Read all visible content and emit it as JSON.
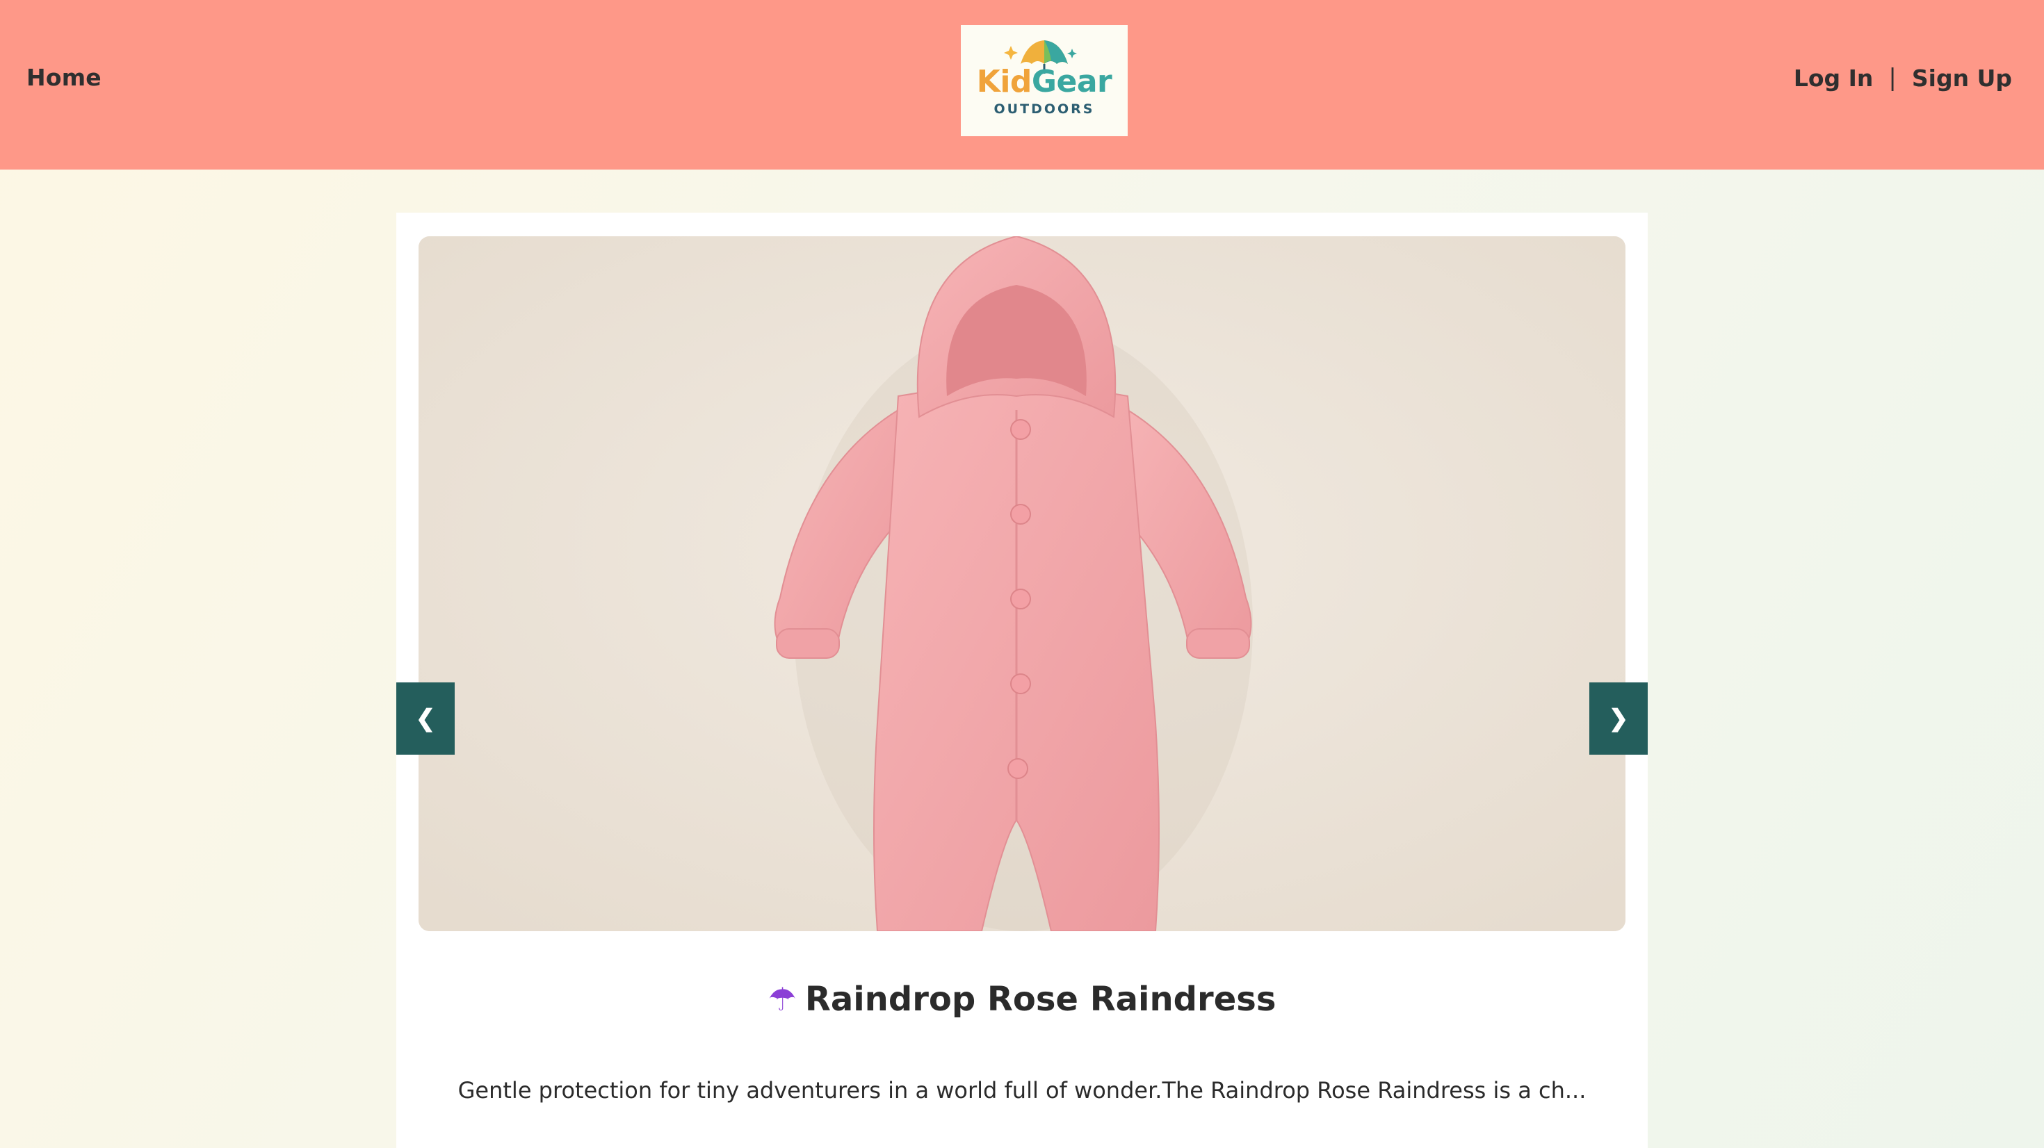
{
  "header": {
    "nav_home": "Home",
    "login": "Log In",
    "separator": "|",
    "signup": "Sign Up",
    "logo": {
      "brand_part1": "Kid",
      "brand_part2": "Gear",
      "tagline": "OUTDOORS"
    }
  },
  "carousel": {
    "prev_label": "❮",
    "next_label": "❯",
    "image_alt": "pink hooded baby rain romper"
  },
  "product": {
    "icon": "☂",
    "title": "Raindrop Rose Raindress",
    "description": "Gentle protection for tiny adventurers in a world full of wonder.The Raindrop Rose Raindress is a ch..."
  },
  "colors": {
    "header_bg": "#fe9888",
    "accent_teal": "#245e5c",
    "romper_pink": "#f2a5a8"
  }
}
